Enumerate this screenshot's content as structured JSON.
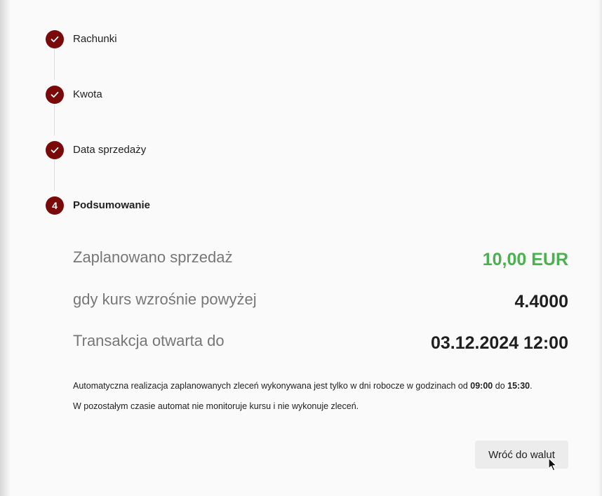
{
  "stepper": {
    "steps": [
      {
        "label": "Rachunki",
        "status": "completed",
        "icon": "check-icon"
      },
      {
        "label": "Kwota",
        "status": "completed",
        "icon": "check-icon"
      },
      {
        "label": "Data sprzedaży",
        "status": "completed",
        "icon": "check-icon"
      },
      {
        "label": "Podsumowanie",
        "status": "active",
        "number": "4"
      }
    ]
  },
  "summary": {
    "rows": [
      {
        "label": "Zaplanowano sprzedaż",
        "value": "10,00 EUR"
      },
      {
        "label": "gdy kurs wzrośnie powyżej",
        "value": "4.4000"
      },
      {
        "label": "Transakcja otwarta do",
        "value": "03.12.2024 12:00"
      }
    ]
  },
  "info": {
    "line1_prefix": "Automatyczna realizacja zaplanowanych zleceń wykonywana jest tylko w dni robocze w godzinach od ",
    "time_from": "09:00",
    "line1_middle": " do ",
    "time_to": "15:30",
    "line1_suffix": ".",
    "line2": "W pozostałym czasie automat nie monitoruje kursu i nie wykonuje zleceń."
  },
  "actions": {
    "back_label": "Wróć do walut"
  },
  "colors": {
    "step_accent": "#7a0a0a",
    "amount_green": "#4caf50",
    "label_gray": "#777777"
  }
}
